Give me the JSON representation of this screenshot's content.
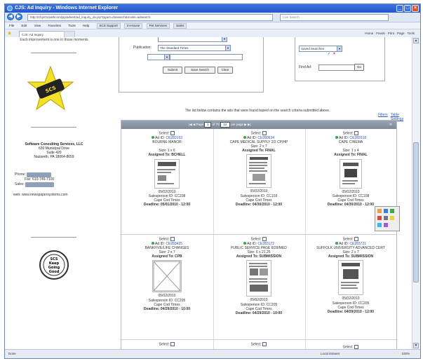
{
  "window": {
    "title": "CJS: Ad Inquiry - Windows Internet Explorer",
    "address": "http://sfcjs01/pathcom/jsp/advert/ad_inquiry_do.jsp?pgact=dosearch&mode=adsearch",
    "search_placeholder": "Live Search"
  },
  "menu": [
    "File",
    "Edit",
    "View",
    "Favorites",
    "Tools",
    "Help"
  ],
  "links_toolbar": [
    "SCS Support",
    "In-House",
    "Pet Services",
    "Sales"
  ],
  "tab_label": "CJS: Ad Inquiry",
  "command_bar": [
    "Home",
    "Feeds",
    "Print",
    "Page",
    "Tools"
  ],
  "left": {
    "tagline": "Each improvement is one in those moments",
    "company_name": "Software Consulting Services, LLC",
    "address_1": "630 Municipal Drive",
    "address_2": "Suite 420",
    "address_3": "Nazareth, PA 18064-8659",
    "phone_label": "Phone:",
    "fax": "Fax: 610-746-7100",
    "sales_label": "Sales:",
    "web": "web: www.newspapersystems.com",
    "seal_text_1": "SCS",
    "seal_text_2": "Keep",
    "seal_text_3": "Going",
    "seal_text_4": "Good"
  },
  "form": {
    "publication_label": "Publication:",
    "publication_value": "The Standard Times",
    "submit_label": "Submit",
    "save_search_label": "Save Search",
    "clear_label": "Clear",
    "saved_search_value": "Saved Searches",
    "find_ad_label": "Find Ad:",
    "go_label": "Go"
  },
  "results_note": "The list below contains the ads that were found based on the search criteria submitted above.",
  "filters_link": "Filters",
  "table_settings_link": "Table Settings",
  "pager": {
    "page_label": "Page",
    "page": "1",
    "of_label": "of 75",
    "per_page": "12",
    "per_page_label": "per page"
  },
  "ads": [
    {
      "select": "Select:",
      "ad_id_label": "Ad ID:",
      "ad_id": "CE283163",
      "title": "BOURNE MANOR",
      "size": "Size: 1 x 6",
      "assigned": "Assigned To: BCHELL",
      "date": "05/02/2010",
      "salesperson": "Salesperson ID: CC208",
      "pub": "Cape Cod Times",
      "deadline": "Deadline: 05/01/2010 - 12:00"
    },
    {
      "select": "Select:",
      "ad_id_label": "Ad ID:",
      "ad_id": "CE280634",
      "title": "CAPE MEDICAL SUPPLY 2/2 CP/HP",
      "size": "Size: 2 x 7",
      "assigned": "Assigned To: FINAL",
      "date": "05/02/2010",
      "salesperson": "Salesperson ID: CC103",
      "pub": "Cape Cod Times",
      "deadline": "Deadline: 04/30/2010 - 12:00"
    },
    {
      "select": "Select:",
      "ad_id_label": "Ad ID:",
      "ad_id": "CE282018",
      "title": "CAPE CINEMA",
      "size": "Size: 1 x 4",
      "assigned": "Assigned To: FINAL",
      "date": "05/02/2010",
      "salesperson": "Salesperson ID: CC108",
      "pub": "Cape Cod Times",
      "deadline": "Deadline: 04/30/2010 - 12:00"
    },
    {
      "select": "Select:",
      "ad_id_label": "Ad ID:",
      "ad_id": "CE283425",
      "title": "BANKFIVE/LIFE CHANGES",
      "size": "Size: 2 x 7",
      "assigned": "Assigned To: CPB",
      "date": "05/02/2010",
      "salesperson": "Salesperson ID: CC205",
      "pub": "Cape Cod Times",
      "deadline": "Deadline: 04/29/2010 - 10:00"
    },
    {
      "select": "Select:",
      "ad_id_label": "Ad ID:",
      "ad_id": "CE283172",
      "title": "PUBLIC SERVICE PAGE 8/29/MED",
      "size": "Size: 6 x 21.25",
      "assigned": "Assigned To: SUBMISSION",
      "date": "05/02/2010",
      "salesperson": "Salesperson ID: CC205",
      "pub": "Cape Cod Times",
      "deadline": "Deadline: 04/29/2010 - 10:00"
    },
    {
      "select": "Select:",
      "ad_id_label": "Ad ID:",
      "ad_id": "CE283721",
      "title": "SUFFOLK UNIVERSITY ADVANCED CERT",
      "size": "Size: 2 x 7",
      "assigned": "Assigned To: SUBMISSION",
      "date": "05/02/2010",
      "salesperson": "Salesperson ID: CC205",
      "pub": "Cape Cod Times",
      "deadline": "Deadline: 04/29/2010 - 12:00"
    }
  ],
  "status": {
    "left": "Done",
    "zone": "Local intranet",
    "zoom": "100%"
  }
}
